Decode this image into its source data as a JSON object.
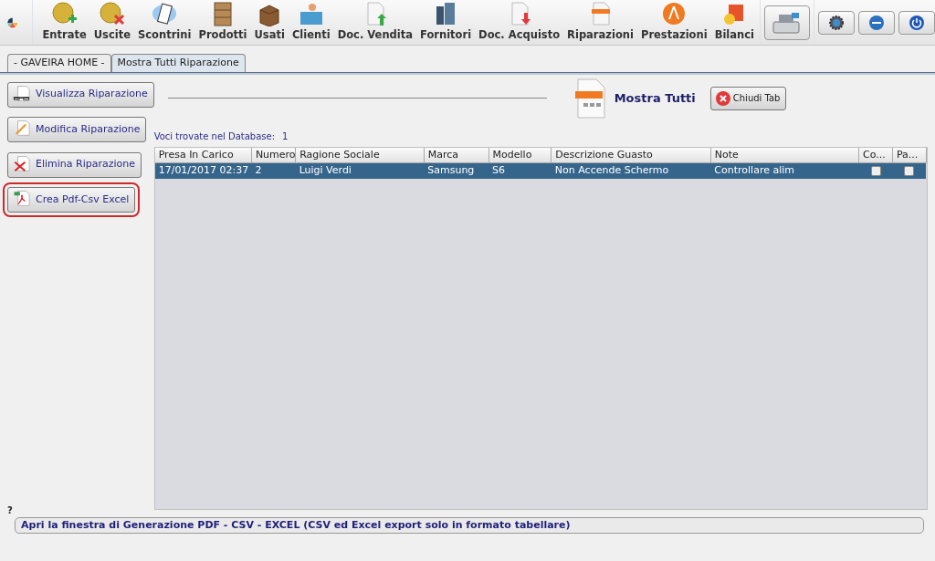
{
  "toolbar": {
    "items": [
      {
        "label": "Entrate"
      },
      {
        "label": "Uscite"
      },
      {
        "label": "Scontrini"
      },
      {
        "label": "Prodotti"
      },
      {
        "label": "Usati"
      },
      {
        "label": "Clienti"
      },
      {
        "label": "Doc. Vendita"
      },
      {
        "label": "Fornitori"
      },
      {
        "label": "Doc. Acquisto"
      },
      {
        "label": "Riparazioni"
      },
      {
        "label": "Prestazioni"
      },
      {
        "label": "Bilanci"
      }
    ]
  },
  "tabs": [
    {
      "label": "- GAVEIRA HOME -",
      "selected": false
    },
    {
      "label": "Mostra Tutti Riparazione",
      "selected": true
    }
  ],
  "actions": [
    {
      "label": "Visualizza Riparazione",
      "highlighted": false
    },
    {
      "label": "Modifica Riparazione",
      "highlighted": false
    },
    {
      "label": "Elimina Riparazione",
      "highlighted": false
    },
    {
      "label": "Crea Pdf-Csv Excel",
      "highlighted": true
    }
  ],
  "header": {
    "title": "Mostra Tutti",
    "close_button": "Chiudi Tab"
  },
  "count": {
    "label": "Voci trovate nel Database:",
    "value": "1"
  },
  "table": {
    "columns": [
      "Presa In Carico",
      "Numero",
      "Ragione Sociale",
      "Marca",
      "Modello",
      "Descrizione Guasto",
      "Note",
      "Co...",
      "Pa..."
    ],
    "rows": [
      {
        "selected": true,
        "cells": [
          "17/01/2017 02:37",
          "2",
          "Luigi  Verdi",
          "Samsung",
          "S6",
          "Non Accende Schermo",
          "Controllare alim"
        ],
        "checks": [
          false,
          false
        ]
      }
    ]
  },
  "status_bar": {
    "hint": "?",
    "message": "Apri la finestra di Generazione PDF - CSV - EXCEL (CSV ed Excel export solo in formato tabellare)"
  }
}
